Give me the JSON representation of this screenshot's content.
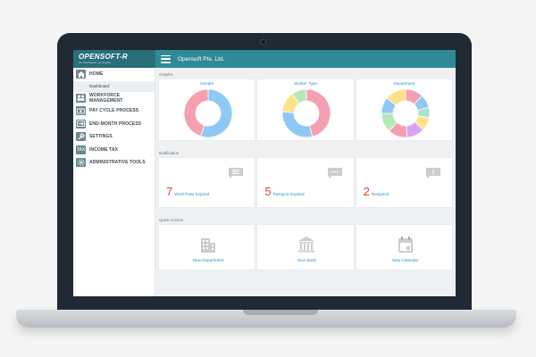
{
  "header": {
    "logo": "OPENSOFT-R",
    "tagline": "be intelligent, go digital",
    "company": "Opensoft Pte. Ltd."
  },
  "sidebar": {
    "items": [
      {
        "label": "HOME",
        "icon": "home-icon"
      },
      {
        "label": "Dashboard",
        "sub": true
      },
      {
        "label": "WORKFORCE MANAGEMENT",
        "icon": "people-icon"
      },
      {
        "label": "PAY CYCLE PROCESS",
        "icon": "pay-icon"
      },
      {
        "label": "END-MONTH PROCESS",
        "icon": "process-icon"
      },
      {
        "label": "SETTINGS",
        "icon": "wrench-icon"
      },
      {
        "label": "INCOME TAX",
        "icon": "tax-icon"
      },
      {
        "label": "ADMINISTRATIVE TOOLS",
        "icon": "admin-icon"
      }
    ],
    "tax_icon_text": "TAX"
  },
  "sections": {
    "graphic": "Graphic",
    "notification": "Notification",
    "quick": "Quick Access"
  },
  "charts": [
    {
      "title": "Gender",
      "slices": [
        {
          "value": 55,
          "color": "#8ec9f5"
        },
        {
          "value": 45,
          "color": "#f4a0b0"
        }
      ]
    },
    {
      "title": "Worker Type",
      "slices": [
        {
          "value": 46,
          "color": "#f4a0b0"
        },
        {
          "value": 30,
          "color": "#8ec9f5"
        },
        {
          "value": 14,
          "color": "#fde28a"
        },
        {
          "value": 10,
          "color": "#b6e8b6"
        }
      ]
    },
    {
      "title": "Department",
      "slices": [
        {
          "value": 12,
          "color": "#f4a0b0"
        },
        {
          "value": 9,
          "color": "#8ec9f5"
        },
        {
          "value": 7,
          "color": "#a8e3d0"
        },
        {
          "value": 9,
          "color": "#fde28a"
        },
        {
          "value": 12,
          "color": "#d6a7f0"
        },
        {
          "value": 13,
          "color": "#f4a0b0"
        },
        {
          "value": 13,
          "color": "#b6e8b6"
        },
        {
          "value": 11,
          "color": "#8ec9f5"
        },
        {
          "value": 14,
          "color": "#fde28a"
        }
      ]
    }
  ],
  "notifications": [
    {
      "count": "7",
      "label": "Work Pass Expired",
      "icon": "list-message-icon"
    },
    {
      "count": "5",
      "label": "Passport Expired",
      "icon": "dots-message-icon"
    },
    {
      "count": "2",
      "label": "Resigned",
      "icon": "alert-message-icon"
    }
  ],
  "quick_access": [
    {
      "label": "New Department",
      "icon": "building-icon"
    },
    {
      "label": "New Bank",
      "icon": "bank-icon"
    },
    {
      "label": "New Calendar",
      "icon": "calendar-icon"
    }
  ]
}
